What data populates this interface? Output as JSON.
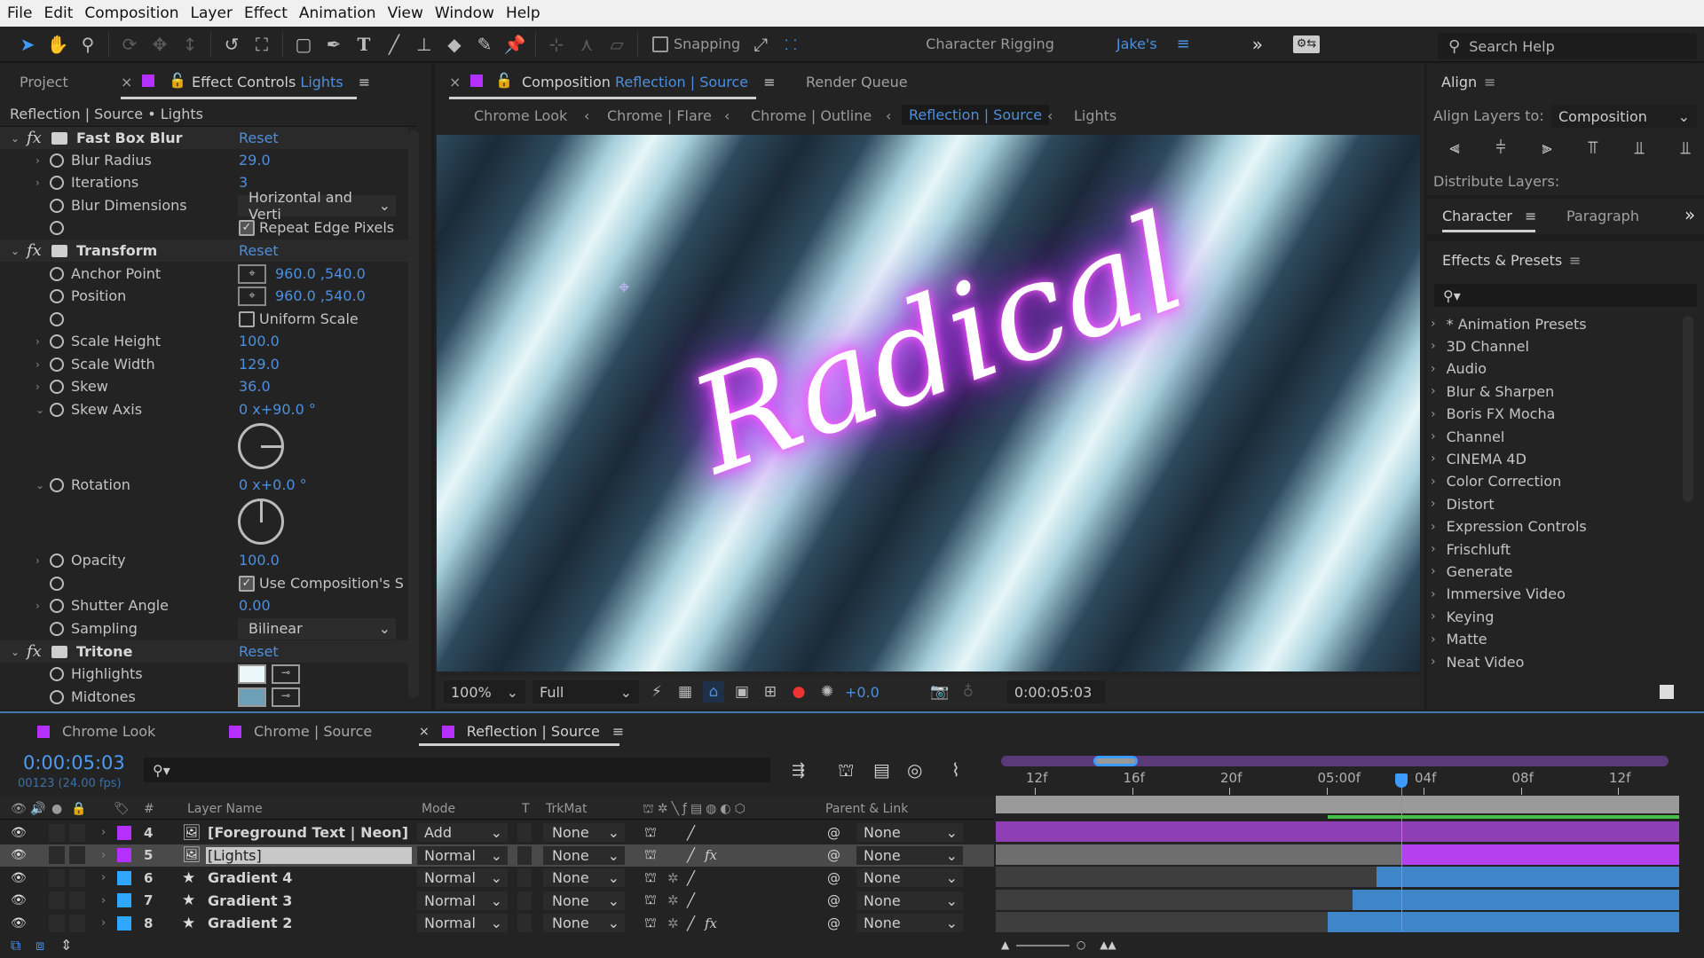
{
  "menu": [
    "File",
    "Edit",
    "Composition",
    "Layer",
    "Effect",
    "Animation",
    "View",
    "Window",
    "Help"
  ],
  "toolbar": {
    "tools": [
      "selection-tool",
      "hand-tool",
      "zoom-tool",
      "orbit-tool",
      "pan-tool",
      "dolly-tool",
      "rotate-tool",
      "pan-behind-tool",
      "rectangle-tool",
      "pen-tool",
      "type-tool",
      "brush-tool",
      "clone-stamp-tool",
      "eraser-tool",
      "roto-brush-tool",
      "puppet-pin-tool"
    ],
    "snapping_label": "Snapping",
    "snapping_checked": false,
    "workspaces": [
      "Character Rigging",
      "Jake's"
    ],
    "active_workspace": "Jake's",
    "search_help_placeholder": "Search Help"
  },
  "left_panel": {
    "tabs": {
      "project": "Project",
      "effect_controls": "Effect Controls",
      "effect_controls_layer": "Lights"
    },
    "breadcrumb": "Reflection | Source • Lights",
    "effects": [
      {
        "name": "Fast Box Blur",
        "reset": "Reset",
        "props": [
          {
            "label": "Blur Radius",
            "value": "29.0"
          },
          {
            "label": "Iterations",
            "value": "3"
          },
          {
            "label": "Blur Dimensions",
            "value": "Horizontal and Verti"
          },
          {
            "label": "",
            "checkbox": "Repeat Edge Pixels",
            "checked": true
          }
        ]
      },
      {
        "name": "Transform",
        "reset": "Reset",
        "props": [
          {
            "label": "Anchor Point",
            "value": "960.0 ,540.0"
          },
          {
            "label": "Position",
            "value": "960.0 ,540.0"
          },
          {
            "label": "",
            "checkbox": "Uniform Scale",
            "checked": false
          },
          {
            "label": "Scale Height",
            "value": "100.0"
          },
          {
            "label": "Scale Width",
            "value": "129.0"
          },
          {
            "label": "Skew",
            "value": "36.0"
          },
          {
            "label": "Skew Axis",
            "value": "0 x+90.0 °"
          },
          {
            "label": "Rotation",
            "value": "0 x+0.0 °"
          },
          {
            "label": "Opacity",
            "value": "100.0"
          },
          {
            "label": "",
            "checkbox": "Use Composition's S",
            "checked": true
          },
          {
            "label": "Shutter Angle",
            "value": "0.00"
          },
          {
            "label": "Sampling",
            "value": "Bilinear"
          }
        ]
      },
      {
        "name": "Tritone",
        "reset": "Reset",
        "props": [
          {
            "label": "Highlights",
            "color": "#eaf8fb"
          },
          {
            "label": "Midtones",
            "color": "#6d9fb8"
          }
        ]
      }
    ]
  },
  "composition": {
    "tab_prefix": "Composition",
    "tab_name": "Reflection | Source",
    "render_queue": "Render Queue",
    "breadcrumbs": [
      "Chrome Look",
      "Chrome | Flare",
      "Chrome | Outline",
      "Reflection | Source",
      "Lights"
    ],
    "active_breadcrumb": "Reflection | Source",
    "viewer_text": "Radical",
    "zoom": "100%",
    "resolution": "Full",
    "exposure": "+0.0",
    "timecode": "0:00:05:03"
  },
  "right_panel": {
    "align": {
      "title": "Align",
      "align_to_label": "Align Layers to:",
      "align_to_value": "Composition",
      "distribute_label": "Distribute Layers:"
    },
    "char_tabs": [
      "Character",
      "Paragraph"
    ],
    "effects_presets": {
      "title": "Effects & Presets",
      "search_placeholder": "",
      "items": [
        "* Animation Presets",
        "3D Channel",
        "Audio",
        "Blur & Sharpen",
        "Boris FX Mocha",
        "Channel",
        "CINEMA 4D",
        "Color Correction",
        "Distort",
        "Expression Controls",
        "Frischluft",
        "Generate",
        "Immersive Video",
        "Keying",
        "Matte",
        "Neat Video"
      ]
    }
  },
  "timeline": {
    "tabs": [
      "Chrome Look",
      "Chrome | Source",
      "Reflection | Source"
    ],
    "active_tab": "Reflection | Source",
    "timecode": "0:00:05:03",
    "frame_info": "00123 (24.00 fps)",
    "columns": {
      "num": "#",
      "layer_name": "Layer Name",
      "mode": "Mode",
      "t": "T",
      "trkmat": "TrkMat",
      "parent": "Parent & Link"
    },
    "ruler": [
      "12f",
      "16f",
      "20f",
      "05:00f",
      "04f",
      "08f",
      "12f"
    ],
    "layers": [
      {
        "num": "4",
        "name": "[Foreground Text | Neon]",
        "type": "precomp",
        "label_color": "#b330ff",
        "mode": "Add",
        "trkmat": "None",
        "fx": false,
        "parent": "None",
        "selected": false,
        "bar_color": "#8e3fb4",
        "bar_start": 0.0
      },
      {
        "num": "5",
        "name": "[Lights]",
        "type": "precomp",
        "label_color": "#b330ff",
        "mode": "Normal",
        "trkmat": "None",
        "fx": true,
        "parent": "None",
        "selected": true,
        "bar_color": "#b540f0",
        "bar_start": 0.594
      },
      {
        "num": "6",
        "name": "Gradient 4",
        "type": "shape",
        "label_color": "#2fa6ff",
        "mode": "Normal",
        "trkmat": "None",
        "fx": false,
        "parent": "None",
        "selected": false,
        "bar_color": "#3f86c8",
        "bar_start": 0.557
      },
      {
        "num": "7",
        "name": "Gradient 3",
        "type": "shape",
        "label_color": "#2fa6ff",
        "mode": "Normal",
        "trkmat": "None",
        "fx": false,
        "parent": "None",
        "selected": false,
        "bar_color": "#3f86c8",
        "bar_start": 0.522
      },
      {
        "num": "8",
        "name": "Gradient 2",
        "type": "shape",
        "label_color": "#2fa6ff",
        "mode": "Normal",
        "trkmat": "None",
        "fx": true,
        "parent": "None",
        "selected": false,
        "bar_color": "#3f86c8",
        "bar_start": 0.486
      }
    ],
    "playhead_position": 0.594,
    "work_area_start": 0.486
  }
}
